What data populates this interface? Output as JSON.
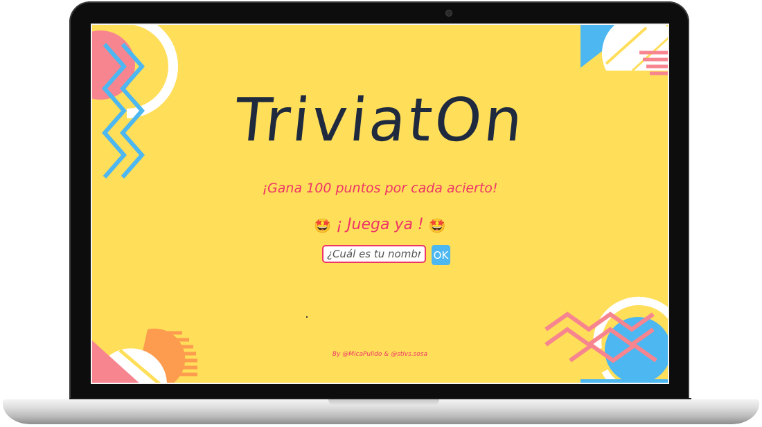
{
  "app": {
    "title": "TriviatOn",
    "tagline": "¡Gana 100 puntos por cada acierto!",
    "play_text": "¡ Juega ya !",
    "emoji": "🤩",
    "credits": "By @MicaPulido & @stivs.sosa"
  },
  "form": {
    "name_placeholder": "¿Cuál es tu nombre?",
    "name_value": "",
    "submit_label": "OK"
  },
  "colors": {
    "background": "#ffde59",
    "title": "#1f2a3f",
    "accent_pink": "#ee3468",
    "accent_blue": "#4cb7f1",
    "deco_salmon": "#f7858f",
    "deco_orange": "#fd9b4e"
  }
}
